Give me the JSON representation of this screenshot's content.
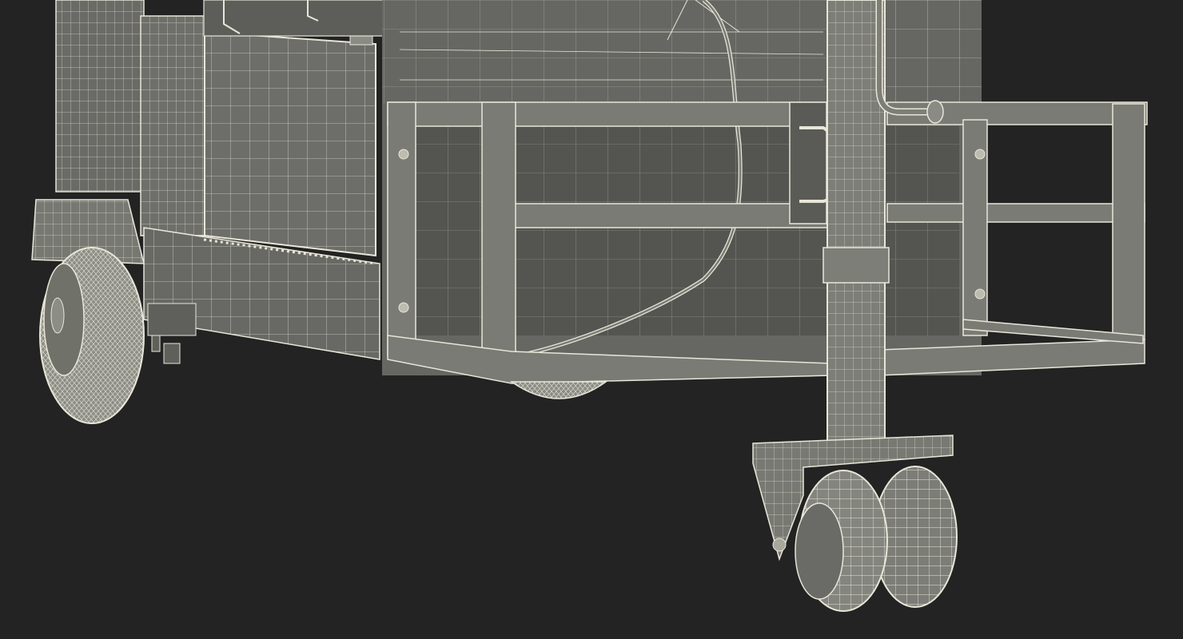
{
  "scene": {
    "subject": "trailer-wireframe-render",
    "colors": {
      "background": "#232323",
      "body_fill": "#6f706a",
      "panel_fill": "#62635e",
      "dark_panel": "#4e4f4b",
      "wire": "#e8e6d8",
      "shadow": "#3a3b38"
    }
  }
}
